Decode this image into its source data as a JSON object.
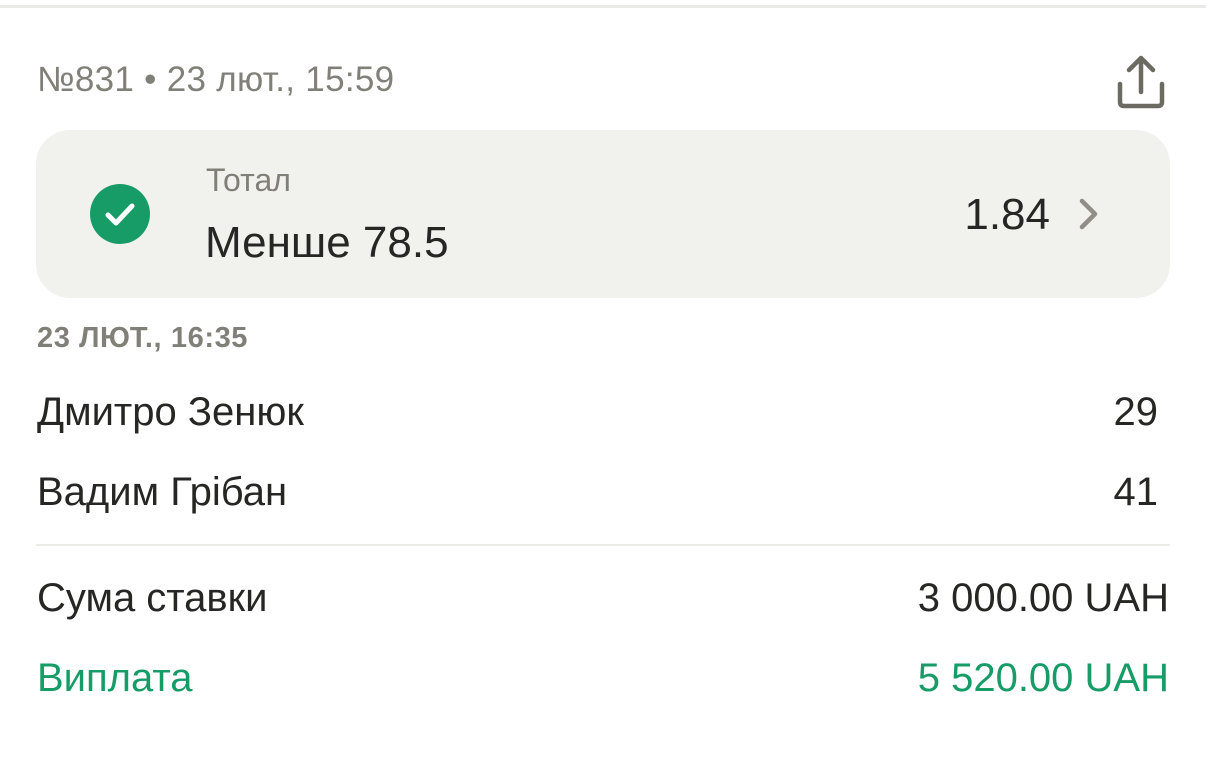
{
  "header": {
    "bet_number": "№831",
    "separator": "•",
    "placed_at": "23 лют., 15:59",
    "share_icon": "share-icon"
  },
  "bet": {
    "status_icon": "check-circle-icon",
    "market": "Тотал",
    "selection": "Менше 78.5",
    "odds": "1.84",
    "chevron_icon": "chevron-right-icon",
    "colors": {
      "status": "#179c67",
      "card_background": "#f1f1ee"
    }
  },
  "event": {
    "start_time": "23 ЛЮТ., 16:35",
    "teams": [
      {
        "name": "Дмитро Зенюк",
        "score": "29"
      },
      {
        "name": "Вадим Грібан",
        "score": "41"
      }
    ]
  },
  "summary": {
    "stake_label": "Сума ставки",
    "stake_value": "3 000.00 UAH",
    "payout_label": "Виплата",
    "payout_value": "5 520.00 UAH",
    "payout_color": "#179c67"
  }
}
